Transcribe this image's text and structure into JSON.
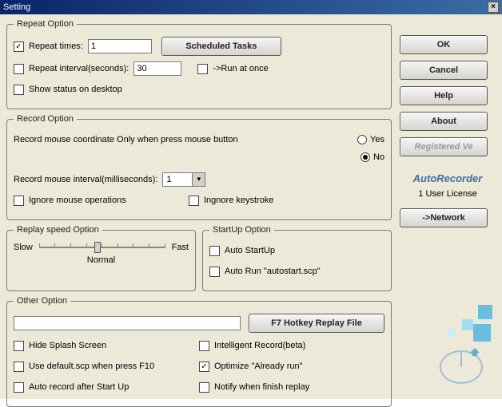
{
  "window": {
    "title": "Setting",
    "close_label": "×"
  },
  "repeat": {
    "legend": "Repeat Option",
    "repeat_times_label": "Repeat times:",
    "repeat_times_value": "1",
    "scheduled_btn": "Scheduled Tasks",
    "repeat_interval_label": "Repeat interval(seconds):",
    "repeat_interval_value": "30",
    "run_at_once_label": "->Run at once",
    "show_status_label": "Show status on desktop"
  },
  "record": {
    "legend": "Record Option",
    "coord_question": "Record mouse coordinate Only when press mouse button",
    "yes": "Yes",
    "no": "No",
    "interval_label": "Record mouse interval(milliseconds):",
    "interval_value": "1",
    "ignore_mouse_label": "Ignore mouse operations",
    "ignore_key_label": "Ingnore keystroke"
  },
  "replay": {
    "legend": "Replay speed Option",
    "slow": "Slow",
    "fast": "Fast",
    "normal": "Normal"
  },
  "startup": {
    "legend": "StartUp Option",
    "auto_startup_label": "Auto StartUp",
    "auto_run_label": "Auto Run \"autostart.scp\""
  },
  "other": {
    "legend": "Other Option",
    "path_value": "",
    "hotkey_btn": "F7 Hotkey Replay File",
    "hide_splash": "Hide Splash Screen",
    "intelligent": "Intelligent Record(beta)",
    "use_default": "Use default.scp when press F10",
    "optimize": "Optimize \"Already run\"",
    "auto_record": "Auto record after Start Up",
    "notify": "Notify when finish replay"
  },
  "buttons": {
    "ok": "OK",
    "cancel": "Cancel",
    "help": "Help",
    "about": "About",
    "registered": "Registered Ve",
    "network": "->Network"
  },
  "brand": {
    "name": "AutoRecorder",
    "license": "1 User License"
  }
}
